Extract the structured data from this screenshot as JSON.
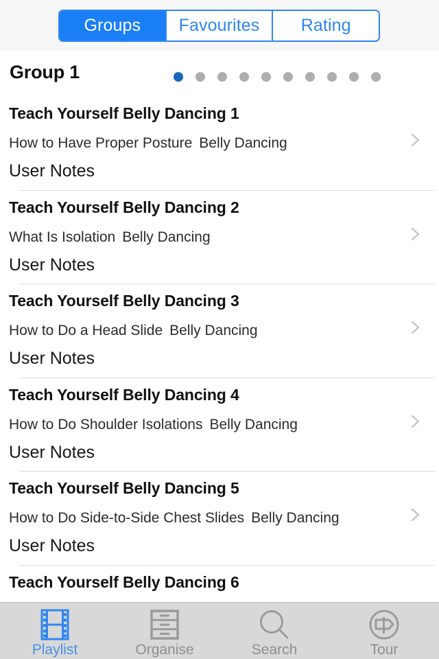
{
  "segmented": {
    "options": [
      {
        "label": "Groups",
        "active": true
      },
      {
        "label": "Favourites",
        "active": false
      },
      {
        "label": "Rating",
        "active": false
      }
    ]
  },
  "group": {
    "title": "Group 1",
    "page_dots": {
      "total": 10,
      "active_index": 0
    }
  },
  "list": {
    "notes_label": "User Notes",
    "rows": [
      {
        "title": "Teach Yourself Belly Dancing 1",
        "subtitle_a": "How to Have Proper Posture",
        "subtitle_b": "Belly Dancing",
        "notes": "User Notes"
      },
      {
        "title": "Teach Yourself Belly Dancing 2",
        "subtitle_a": "What Is Isolation",
        "subtitle_b": "Belly Dancing",
        "notes": "User Notes"
      },
      {
        "title": "Teach Yourself Belly Dancing 3",
        "subtitle_a": "How to Do a Head Slide",
        "subtitle_b": "Belly Dancing",
        "notes": "User Notes"
      },
      {
        "title": "Teach Yourself Belly Dancing 4",
        "subtitle_a": "How to Do Shoulder Isolations",
        "subtitle_b": "Belly Dancing",
        "notes": "User Notes"
      },
      {
        "title": "Teach Yourself Belly Dancing 5",
        "subtitle_a": "How to Do Side-to-Side Chest Slides",
        "subtitle_b": "Belly Dancing",
        "notes": "User Notes"
      },
      {
        "title": "Teach Yourself Belly Dancing 6",
        "subtitle_a": "",
        "subtitle_b": "",
        "notes": ""
      }
    ]
  },
  "tabbar": {
    "tabs": [
      {
        "label": "Playlist",
        "icon": "film-strip-icon",
        "active": true
      },
      {
        "label": "Organise",
        "icon": "file-cabinet-icon",
        "active": false
      },
      {
        "label": "Search",
        "icon": "search-icon",
        "active": false
      },
      {
        "label": "Tour",
        "icon": "signpost-icon",
        "active": false
      }
    ]
  },
  "colors": {
    "accent_blue": "#1a7ef6",
    "segment_border": "#2f86f0",
    "tab_active": "#4a90e2",
    "tab_inactive": "#8e8e8e",
    "dot_active": "#1668bd",
    "dot_inactive": "#aeaeae",
    "header_bg": "#f7f7f7",
    "tabbar_bg": "#d8d8d8"
  }
}
